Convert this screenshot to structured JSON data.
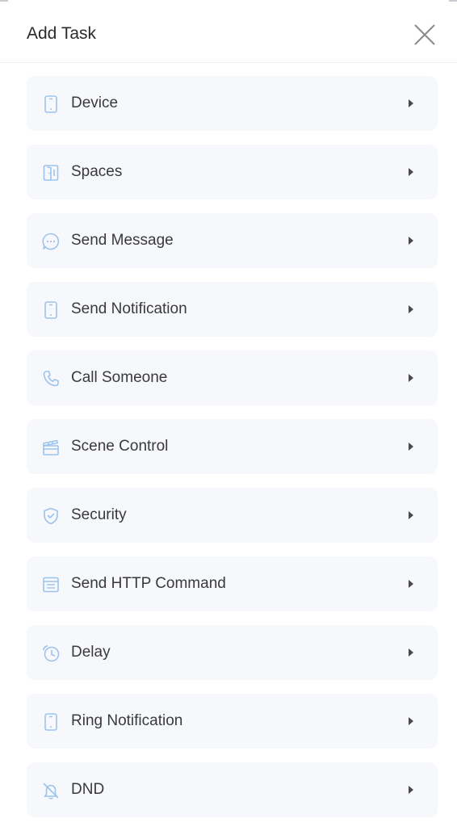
{
  "header": {
    "title": "Add Task",
    "close_icon": "close-icon"
  },
  "colors": {
    "icon_accent": "#9cc3ee",
    "row_background": "#f6f8fc",
    "arrow": "#4a4a4a"
  },
  "items": [
    {
      "label": "Device",
      "icon": "phone-icon"
    },
    {
      "label": "Spaces",
      "icon": "door-icon"
    },
    {
      "label": "Send Message",
      "icon": "message-bubble-icon"
    },
    {
      "label": "Send Notification",
      "icon": "phone-icon"
    },
    {
      "label": "Call Someone",
      "icon": "phone-call-icon"
    },
    {
      "label": "Scene Control",
      "icon": "clapperboard-icon"
    },
    {
      "label": "Security",
      "icon": "shield-icon"
    },
    {
      "label": "Send HTTP Command",
      "icon": "http-window-icon"
    },
    {
      "label": "Delay",
      "icon": "alarm-clock-icon"
    },
    {
      "label": "Ring Notification",
      "icon": "phone-icon"
    },
    {
      "label": "DND",
      "icon": "bell-off-icon"
    }
  ]
}
